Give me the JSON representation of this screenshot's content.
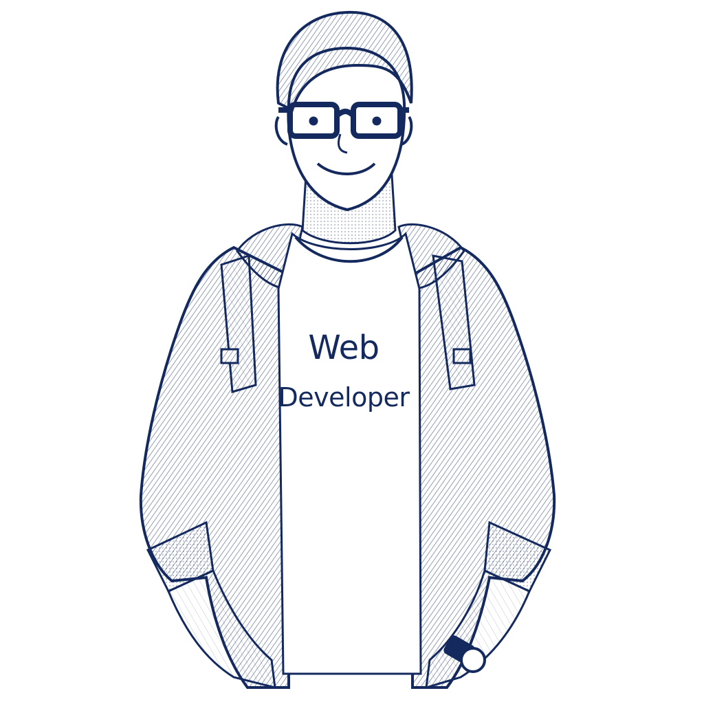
{
  "illustration": {
    "shirt_text_line1": "Web",
    "shirt_text_line2": "Developer",
    "ink_color": "#142a5e",
    "background_color": "#ffffff"
  }
}
